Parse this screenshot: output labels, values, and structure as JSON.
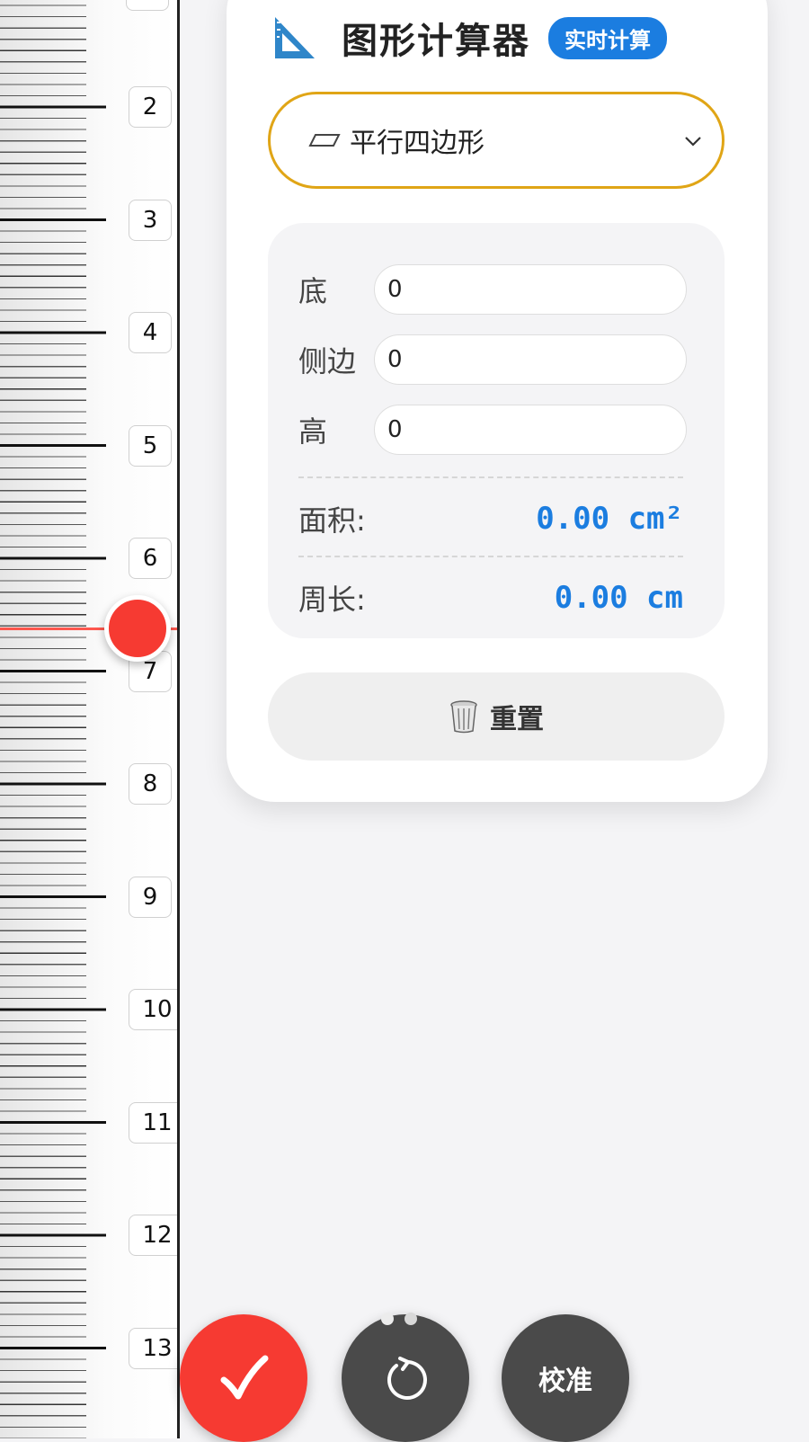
{
  "ruler": {
    "labels": [
      "2",
      "3",
      "4",
      "5",
      "6",
      "7",
      "8",
      "9",
      "10",
      "11",
      "12",
      "13"
    ],
    "unit": "cm",
    "indicator_reading": 6.55
  },
  "calculator": {
    "title": "图形计算器",
    "badge": "实时计算",
    "shape_select": {
      "selected": "平行四边形",
      "icon": "parallelogram-icon"
    },
    "fields": [
      {
        "label": "底",
        "value": "0"
      },
      {
        "label": "侧边",
        "value": "0"
      },
      {
        "label": "高",
        "value": "0"
      }
    ],
    "results": {
      "area_label": "面积:",
      "area_value": "0.00 cm²",
      "perimeter_label": "周长:",
      "perimeter_value": "0.00 cm"
    },
    "reset_label": "重置"
  },
  "actions": {
    "confirm_icon": "check-icon",
    "rotate_icon": "rotate-icon",
    "calibrate_label": "校准"
  },
  "pager": {
    "count": 2,
    "active_index": 0
  },
  "colors": {
    "accent_blue": "#1b7de0",
    "select_border": "#e0a516",
    "indicator_red": "#f63a32",
    "dark_button": "#4a4a4a"
  }
}
